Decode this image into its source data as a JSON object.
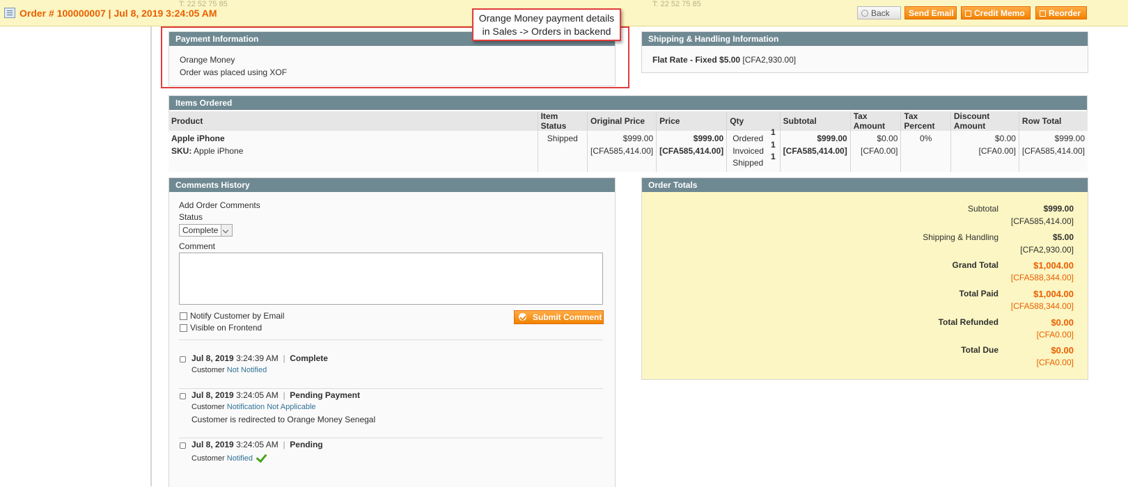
{
  "header": {
    "title": "Order # 100000007 | Jul 8, 2019 3:24:05 AM",
    "ghost_left": "T: 22 52 75 85",
    "ghost_right": "T: 22 52 75 85",
    "buttons": {
      "back": "Back",
      "send_email": "Send Email",
      "credit_memo": "Credit Memo",
      "reorder": "Reorder"
    }
  },
  "callout": {
    "line1": "Orange Money payment details",
    "line2": "in Sales -> Orders in backend"
  },
  "payment": {
    "heading": "Payment Information",
    "method": "Orange Money",
    "note": "Order was placed using XOF"
  },
  "shipping": {
    "heading": "Shipping & Handling Information",
    "method": "Flat Rate - Fixed $5.00",
    "converted": "[CFA2,930.00]"
  },
  "items": {
    "heading": "Items Ordered",
    "columns": [
      "Product",
      "Item Status",
      "Original Price",
      "Price",
      "Qty",
      "Subtotal",
      "Tax Amount",
      "Tax Percent",
      "Discount Amount",
      "Row Total"
    ],
    "row": {
      "product_name": "Apple iPhone",
      "sku_label": "SKU:",
      "sku": "Apple iPhone",
      "status": "Shipped",
      "original_price": "$999.00",
      "original_price_cfa": "[CFA585,414.00]",
      "price": "$999.00",
      "price_cfa": "[CFA585,414.00]",
      "qty_ordered_label": "Ordered",
      "qty_ordered": "1",
      "qty_invoiced_label": "Invoiced",
      "qty_invoiced": "1",
      "qty_shipped_label": "Shipped",
      "qty_shipped": "1",
      "subtotal": "$999.00",
      "subtotal_cfa": "[CFA585,414.00]",
      "tax_amount": "$0.00",
      "tax_amount_cfa": "[CFA0.00]",
      "tax_percent": "0%",
      "discount": "$0.00",
      "discount_cfa": "[CFA0.00]",
      "row_total": "$999.00",
      "row_total_cfa": "[CFA585,414.00]"
    }
  },
  "comments": {
    "heading": "Comments History",
    "add_label": "Add Order Comments",
    "status_label": "Status",
    "status_value": "Complete",
    "comment_label": "Comment",
    "notify_label": "Notify Customer by Email",
    "visible_label": "Visible on Frontend",
    "submit_label": "Submit Comment",
    "history": [
      {
        "date": "Jul 8, 2019",
        "time": "3:24:39 AM",
        "status": "Complete",
        "customer_label": "Customer",
        "customer_state": "Not Notified",
        "message": ""
      },
      {
        "date": "Jul 8, 2019",
        "time": "3:24:05 AM",
        "status": "Pending Payment",
        "customer_label": "Customer",
        "customer_state": "Notification Not Applicable",
        "message": "Customer is redirected to Orange Money Senegal"
      },
      {
        "date": "Jul 8, 2019",
        "time": "3:24:05 AM",
        "status": "Pending",
        "customer_label": "Customer",
        "customer_state": "Notified",
        "message": ""
      }
    ]
  },
  "totals": {
    "heading": "Order Totals",
    "rows": [
      {
        "label": "Subtotal",
        "value": "$999.00",
        "cfa": "[CFA585,414.00]"
      },
      {
        "label": "Shipping & Handling",
        "value": "$5.00",
        "cfa": "[CFA2,930.00]"
      },
      {
        "label": "Grand Total",
        "value": "$1,004.00",
        "cfa": "[CFA588,344.00]"
      },
      {
        "label": "Total Paid",
        "value": "$1,004.00",
        "cfa": "[CFA588,344.00]"
      },
      {
        "label": "Total Refunded",
        "value": "$0.00",
        "cfa": "[CFA0.00]"
      },
      {
        "label": "Total Due",
        "value": "$0.00",
        "cfa": "[CFA0.00]"
      }
    ]
  },
  "colors": {
    "accent": "#eb5e00",
    "header_bg": "#fbf6c3",
    "section_head": "#6f8992",
    "callout_border": "#e03c3c",
    "link": "#2f7296"
  }
}
